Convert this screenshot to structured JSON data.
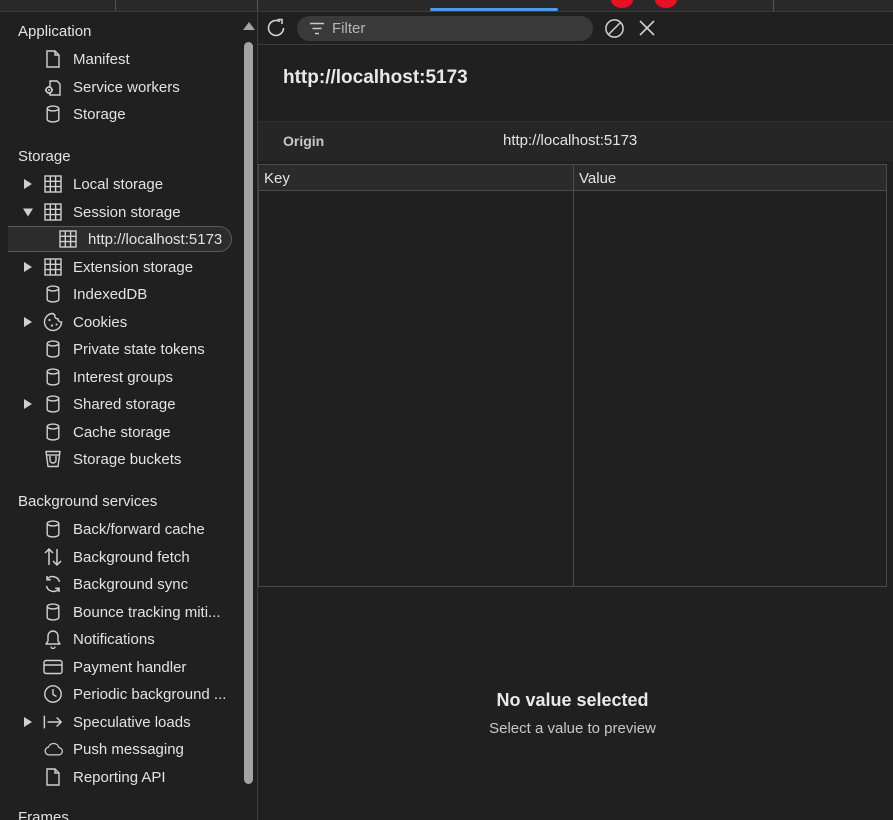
{
  "sidebar": {
    "application_title": "Application",
    "application_items": [
      {
        "label": "Manifest",
        "icon": "document-icon"
      },
      {
        "label": "Service workers",
        "icon": "gears-icon"
      },
      {
        "label": "Storage",
        "icon": "database-icon"
      }
    ],
    "storage_title": "Storage",
    "storage_items": [
      {
        "label": "Local storage",
        "icon": "table-icon"
      },
      {
        "label": "Session storage",
        "icon": "table-icon"
      },
      {
        "label": "http://localhost:5173",
        "icon": "table-icon"
      },
      {
        "label": "Extension storage",
        "icon": "table-icon"
      },
      {
        "label": "IndexedDB",
        "icon": "database-icon"
      },
      {
        "label": "Cookies",
        "icon": "cookie-icon"
      },
      {
        "label": "Private state tokens",
        "icon": "database-icon"
      },
      {
        "label": "Interest groups",
        "icon": "database-icon"
      },
      {
        "label": "Shared storage",
        "icon": "database-icon"
      },
      {
        "label": "Cache storage",
        "icon": "database-icon"
      },
      {
        "label": "Storage buckets",
        "icon": "bucket-icon"
      }
    ],
    "background_title": "Background services",
    "background_items": [
      {
        "label": "Back/forward cache",
        "icon": "database-icon"
      },
      {
        "label": "Background fetch",
        "icon": "up-down-arrows-icon"
      },
      {
        "label": "Background sync",
        "icon": "sync-icon"
      },
      {
        "label": "Bounce tracking miti...",
        "icon": "database-icon"
      },
      {
        "label": "Notifications",
        "icon": "bell-icon"
      },
      {
        "label": "Payment handler",
        "icon": "credit-card-icon"
      },
      {
        "label": "Periodic background ...",
        "icon": "clock-icon"
      },
      {
        "label": "Speculative loads",
        "icon": "arrow-right-bar-icon"
      },
      {
        "label": "Push messaging",
        "icon": "cloud-icon"
      },
      {
        "label": "Reporting API",
        "icon": "document-icon"
      }
    ],
    "frames_title": "Frames"
  },
  "toolbar": {
    "filter_placeholder": "Filter"
  },
  "main": {
    "title": "http://localhost:5173",
    "origin_label": "Origin",
    "origin_value": "http://localhost:5173",
    "columns": [
      "Key",
      "Value"
    ],
    "rows": [],
    "preview_title": "No value selected",
    "preview_subtitle": "Select a value to preview"
  },
  "colors": {
    "background": "#202020",
    "accent": "#4c9ae8",
    "text": "#e3e3e3"
  }
}
